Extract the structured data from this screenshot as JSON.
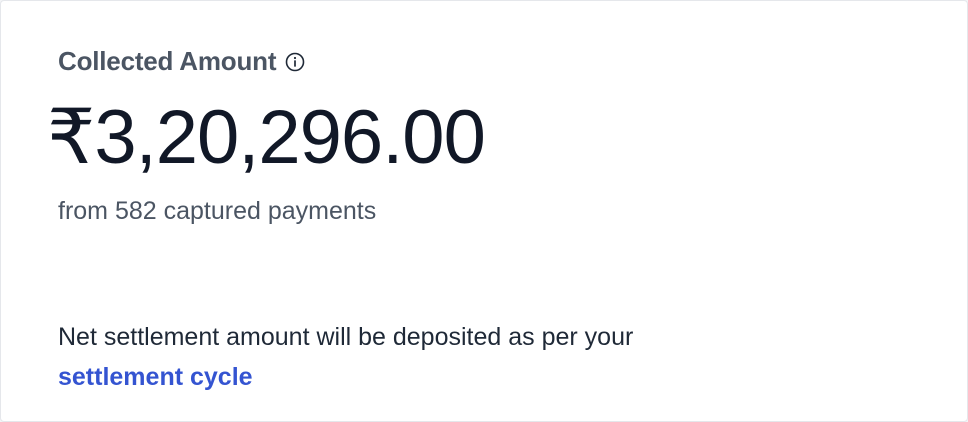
{
  "card": {
    "title": "Collected Amount",
    "info_icon": "info-circle-icon",
    "amount": "₹3,20,296.00",
    "subtext": "from 582 captured payments",
    "note_text": "Net settlement amount will be deposited as per your",
    "note_link": "settlement cycle"
  },
  "colors": {
    "title": "#4b5563",
    "amount": "#111827",
    "link": "#3454d1"
  }
}
